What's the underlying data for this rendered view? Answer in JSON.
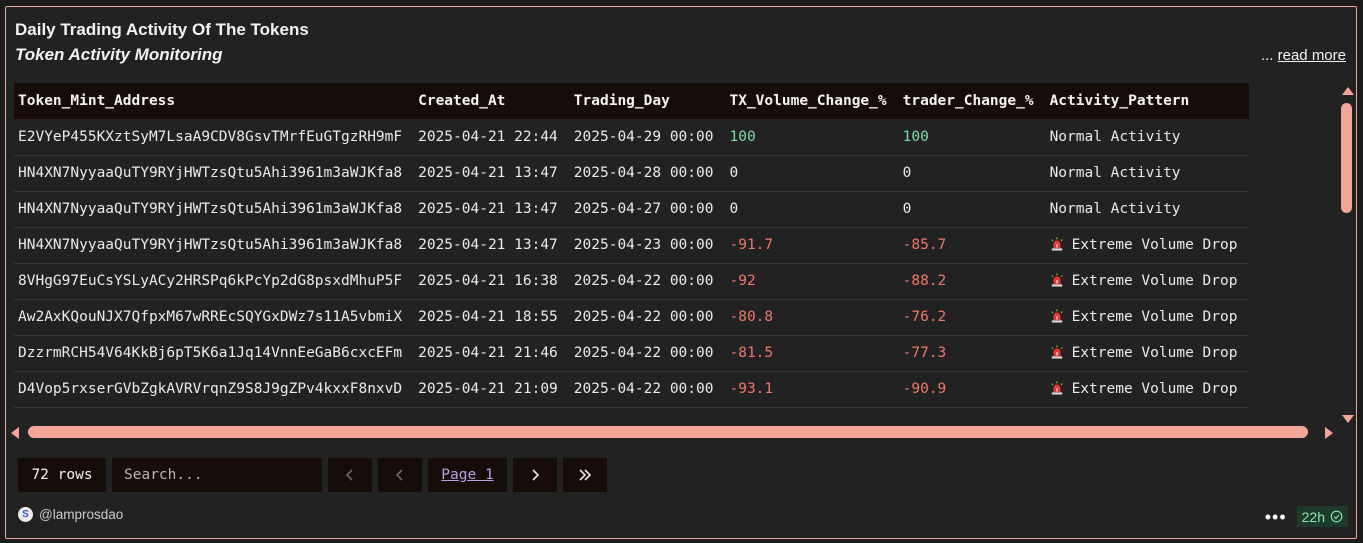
{
  "header": {
    "title": "Daily Trading Activity Of The Tokens",
    "subtitle": "Token Activity Monitoring",
    "ellipsis": "...",
    "read_more": "read more"
  },
  "table": {
    "columns": [
      "Token_Mint_Address",
      "Created_At",
      "Trading_Day",
      "TX_Volume_Change_%",
      "trader_Change_%",
      "Activity_Pattern"
    ],
    "rows": [
      {
        "address": "E2VYeP455KXztSyM7LsaA9CDV8GsvTMrfEuGTgzRH9mF",
        "created": "2025-04-21 22:44",
        "day": "2025-04-29 00:00",
        "tx": "100",
        "trader": "100",
        "pattern": "Normal Activity",
        "alert": false,
        "tone": "pos"
      },
      {
        "address": "HN4XN7NyyaaQuTY9RYjHWTzsQtu5Ahi3961m3aWJKfa8",
        "created": "2025-04-21 13:47",
        "day": "2025-04-28 00:00",
        "tx": "0",
        "trader": "0",
        "pattern": "Normal Activity",
        "alert": false,
        "tone": "zero"
      },
      {
        "address": "HN4XN7NyyaaQuTY9RYjHWTzsQtu5Ahi3961m3aWJKfa8",
        "created": "2025-04-21 13:47",
        "day": "2025-04-27 00:00",
        "tx": "0",
        "trader": "0",
        "pattern": "Normal Activity",
        "alert": false,
        "tone": "zero"
      },
      {
        "address": "HN4XN7NyyaaQuTY9RYjHWTzsQtu5Ahi3961m3aWJKfa8",
        "created": "2025-04-21 13:47",
        "day": "2025-04-23 00:00",
        "tx": "-91.7",
        "trader": "-85.7",
        "pattern": "Extreme Volume Drop",
        "alert": true,
        "tone": "neg"
      },
      {
        "address": "8VHgG97EuCsYSLyACy2HRSPq6kPcYp2dG8psxdMhuP5F",
        "created": "2025-04-21 16:38",
        "day": "2025-04-22 00:00",
        "tx": "-92",
        "trader": "-88.2",
        "pattern": "Extreme Volume Drop",
        "alert": true,
        "tone": "neg"
      },
      {
        "address": "Aw2AxKQouNJX7QfpxM67wRREcSQYGxDWz7s11A5vbmiX",
        "created": "2025-04-21 18:55",
        "day": "2025-04-22 00:00",
        "tx": "-80.8",
        "trader": "-76.2",
        "pattern": "Extreme Volume Drop",
        "alert": true,
        "tone": "neg"
      },
      {
        "address": "DzzrmRCH54V64KkBj6pT5K6a1Jq14VnnEeGaB6cxcEFm",
        "created": "2025-04-21 21:46",
        "day": "2025-04-22 00:00",
        "tx": "-81.5",
        "trader": "-77.3",
        "pattern": "Extreme Volume Drop",
        "alert": true,
        "tone": "neg"
      },
      {
        "address": "D4Vop5rxserGVbZgkAVRVrqnZ9S8J9gZPv4kxxF8nxvD",
        "created": "2025-04-21 21:09",
        "day": "2025-04-22 00:00",
        "tx": "-93.1",
        "trader": "-90.9",
        "pattern": "Extreme Volume Drop",
        "alert": true,
        "tone": "neg"
      }
    ]
  },
  "pagination": {
    "rows_label": "72 rows",
    "search_placeholder": "Search...",
    "page_label": "Page 1"
  },
  "footer": {
    "author": "@lamprosdao",
    "refresh_age": "22h",
    "logo_glyph": "S"
  },
  "colors": {
    "accent": "#f3a697",
    "positive": "#7fdba4",
    "negative": "#f0786a",
    "link": "#b4a3e6"
  }
}
